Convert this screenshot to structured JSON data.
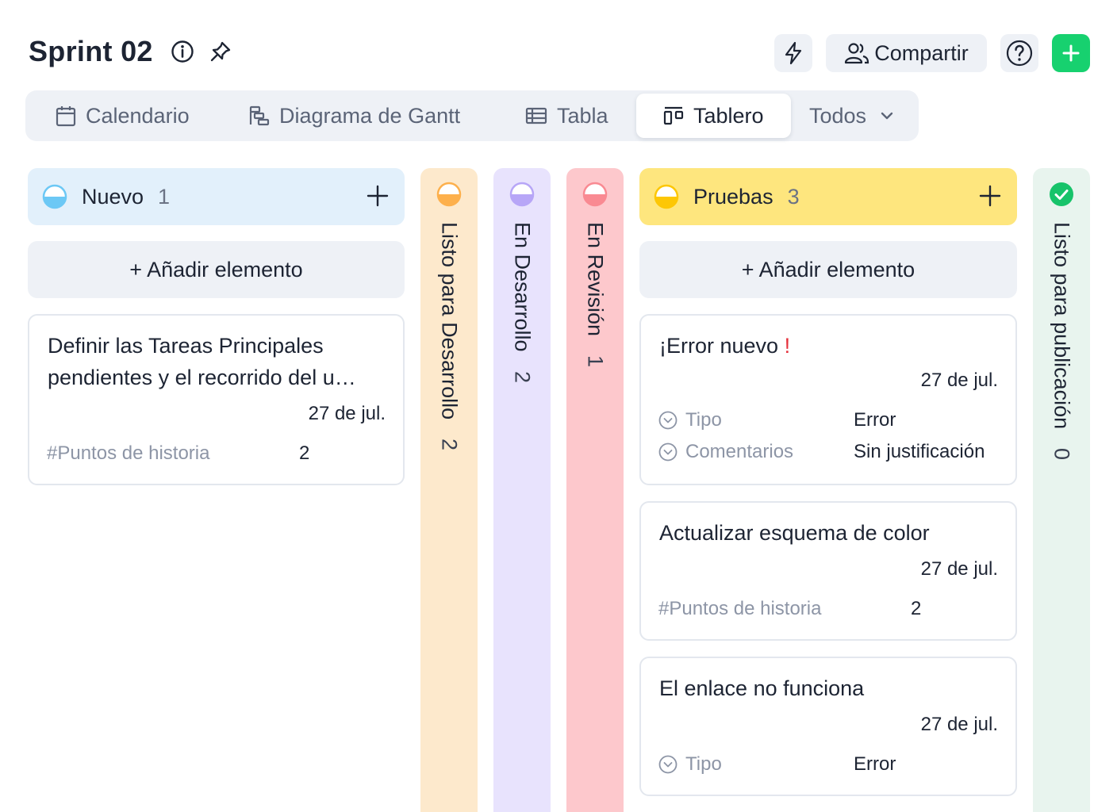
{
  "header": {
    "title": "Sprint 02",
    "share_label": "Compartir"
  },
  "tabs": [
    {
      "label": "Calendario",
      "icon": "calendar-icon",
      "active": false
    },
    {
      "label": "Diagrama de Gantt",
      "icon": "gantt-icon",
      "active": false
    },
    {
      "label": "Tabla",
      "icon": "table-icon",
      "active": false
    },
    {
      "label": "Tablero",
      "icon": "board-icon",
      "active": true
    },
    {
      "label": "Todos",
      "icon": "chevron-down-icon",
      "active": false
    }
  ],
  "columns": {
    "nuevo": {
      "name": "Nuevo",
      "count": "1",
      "color": "#e2f0fb",
      "dot": "#6cc8f5"
    },
    "listo_desarrollo": {
      "name": "Listo para Desarrollo",
      "count": "2",
      "color": "#fde9cc",
      "dot": "#fdb04c"
    },
    "en_desarrollo": {
      "name": "En Desarrollo",
      "count": "2",
      "color": "#e8e3fd",
      "dot": "#b7a6f7"
    },
    "en_revision": {
      "name": "En Revisión",
      "count": "1",
      "color": "#fdc8cc",
      "dot": "#f98a92"
    },
    "pruebas": {
      "name": "Pruebas",
      "count": "3",
      "color": "#fee67e",
      "dot": "#fdc705"
    },
    "listo_publicacion": {
      "name": "Listo para publicación",
      "count": "0",
      "color": "#e8f4ee",
      "dot": "#17c36a"
    }
  },
  "add_item_label": "+ Añadir elemento",
  "cards": {
    "c1": {
      "title": "Definir las Tareas Principales pendientes y el recorrido del u…",
      "date": "27 de jul.",
      "field_label": "#Puntos de historia",
      "field_value": "2"
    },
    "c2": {
      "title": "¡Error nuevo",
      "title_mark": "!",
      "date": "27 de jul.",
      "field1_label": "Tipo",
      "field1_value": "Error",
      "field2_label": "Comentarios",
      "field2_value": "Sin justificación"
    },
    "c3": {
      "title": "Actualizar esquema de color",
      "date": "27 de jul.",
      "field_label": "#Puntos de historia",
      "field_value": "2"
    },
    "c4": {
      "title": "El enlace no funciona",
      "date": "27 de jul.",
      "field_label": "Tipo",
      "field_value": "Error"
    }
  }
}
